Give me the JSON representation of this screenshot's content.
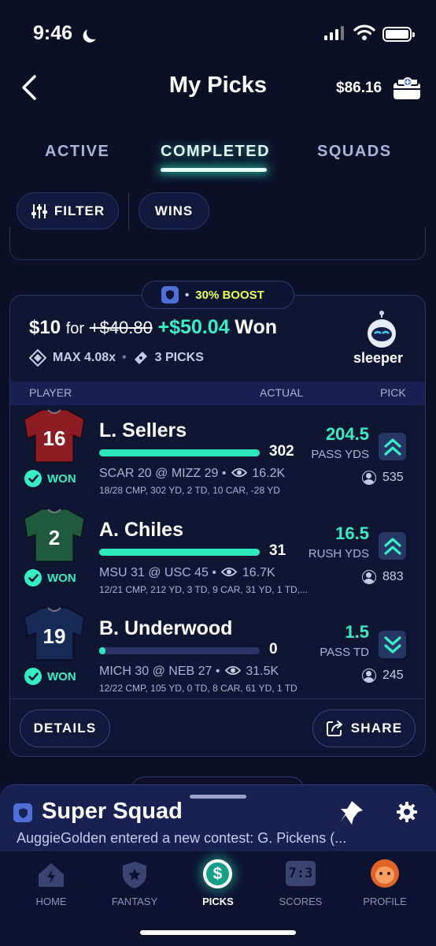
{
  "status_bar": {
    "time": "9:46"
  },
  "header": {
    "title": "My Picks",
    "balance": "$86.16"
  },
  "tabs": [
    {
      "label": "ACTIVE"
    },
    {
      "label": "COMPLETED",
      "active": true
    },
    {
      "label": "SQUADS"
    }
  ],
  "filters": {
    "filter_label": "FILTER",
    "wins_label": "WINS"
  },
  "card": {
    "boost": {
      "bullet": "•",
      "label": "30% BOOST"
    },
    "entry_amount": "$10",
    "for_word": "for",
    "original_payout": "+$40.80",
    "won_amount": "+$50.04",
    "won_word": "Won",
    "max_multiplier": "MAX 4.08x",
    "meta_separator": "•",
    "picks_count": "3 PICKS",
    "platform": "sleeper",
    "columns": {
      "player": "PLAYER",
      "actual": "ACTUAL",
      "pick": "PICK"
    },
    "players": [
      {
        "jersey_number": "16",
        "jersey_color": "#8c1b22",
        "result": "WON",
        "name": "L. Sellers",
        "actual": "302",
        "actual_fraction": 1.0,
        "game": "SCAR 20 @ MIZZ 29 •",
        "views": "16.2K",
        "stats": "18/28 CMP, 302 YD, 2 TD, 10 CAR, -28 YD",
        "pick_value": "204.5",
        "pick_stat": "PASS YDS",
        "direction": "up",
        "pickers": "535"
      },
      {
        "jersey_number": "2",
        "jersey_color": "#1f5a3e",
        "result": "WON",
        "name": "A. Chiles",
        "actual": "31",
        "actual_fraction": 1.0,
        "game": "MSU 31 @ USC 45 •",
        "views": "16.7K",
        "stats": "12/21 CMP, 212 YD, 3 TD, 9 CAR, 31 YD, 1 TD,...",
        "pick_value": "16.5",
        "pick_stat": "RUSH YDS",
        "direction": "up",
        "pickers": "883"
      },
      {
        "jersey_number": "19",
        "jersey_color": "#152a55",
        "result": "WON",
        "name": "B. Underwood",
        "actual": "0",
        "actual_fraction": 0.04,
        "game": "MICH 30 @ NEB 27 •",
        "views": "31.5K",
        "stats": "12/22 CMP, 105 YD, 0 TD, 8 CAR, 61 YD, 1 TD",
        "pick_value": "1.5",
        "pick_stat": "PASS TD",
        "direction": "down",
        "pickers": "245"
      }
    ],
    "details_label": "DETAILS",
    "share_label": "SHARE"
  },
  "squad": {
    "title": "Super Squad",
    "message": "AuggieGolden entered a new contest: G. Pickens (..."
  },
  "tabbar": [
    {
      "label": "HOME",
      "icon": "home-icon"
    },
    {
      "label": "FANTASY",
      "icon": "shield-star-icon"
    },
    {
      "label": "PICKS",
      "icon": "dollar-icon",
      "active": true
    },
    {
      "label": "SCORES",
      "icon": "scoreboard-icon"
    },
    {
      "label": "PROFILE",
      "icon": "avatar-icon"
    }
  ],
  "colors": {
    "accent": "#2de8bd",
    "background": "#0b1027",
    "boost": "#eaff54"
  }
}
